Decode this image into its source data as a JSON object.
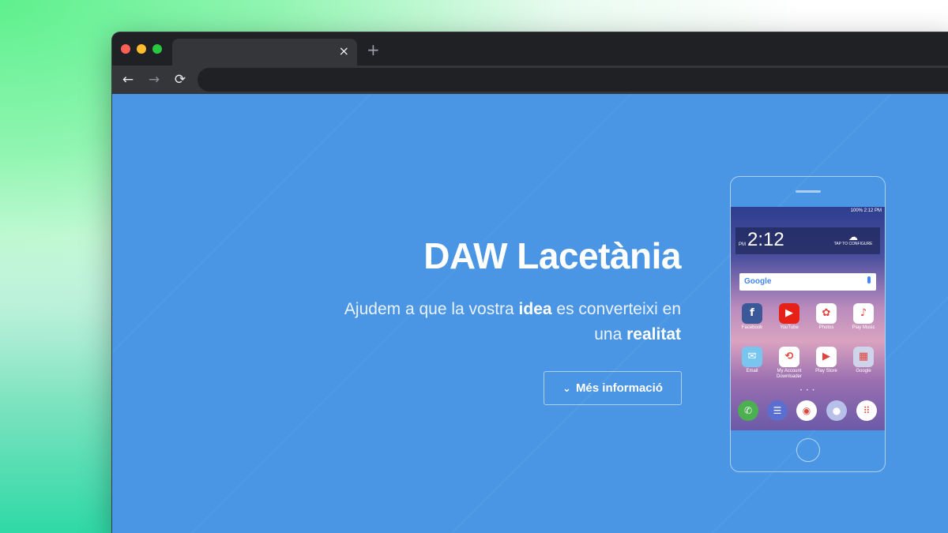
{
  "browser": {
    "tab_close": "×",
    "new_tab": "+",
    "nav": {
      "back": "←",
      "forward": "→",
      "reload": "⟳"
    }
  },
  "hero": {
    "title": "DAW Lacetània",
    "subtitle_1": "Ajudem a que la vostra ",
    "subtitle_bold_1": "idea",
    "subtitle_2": " es converteixi en una ",
    "subtitle_bold_2": "realitat",
    "button_icon": "chevron-down-icon",
    "button_label": "Més informació"
  },
  "phone": {
    "status": "100% 2:12 PM",
    "clock_ampm": "PM",
    "clock_time": "2:12",
    "weather_label": "TAP TO CONFIGURE",
    "search_logo": "Google",
    "apps": [
      {
        "label": "Facebook",
        "glyph": "f",
        "color": "#3b5998"
      },
      {
        "label": "YouTube",
        "glyph": "▶",
        "color": "#e62117"
      },
      {
        "label": "Photos",
        "glyph": "✿",
        "color": "#ffffff"
      },
      {
        "label": "Play Music",
        "glyph": "♪",
        "color": "#ffffff"
      },
      {
        "label": "Email",
        "glyph": "✉",
        "color": "#78c6f0"
      },
      {
        "label": "My Account Downloader",
        "glyph": "⟲",
        "color": "#ffffff"
      },
      {
        "label": "Play Store",
        "glyph": "▶",
        "color": "#ffffff"
      },
      {
        "label": "Google",
        "glyph": "▦",
        "color": "#d0d4ea"
      }
    ],
    "pager": "• • •",
    "dock": [
      {
        "name": "phone-icon",
        "glyph": "✆",
        "color": "#4caf50"
      },
      {
        "name": "messages-icon",
        "glyph": "☰",
        "color": "#5a6fd0"
      },
      {
        "name": "chrome-icon",
        "glyph": "◉",
        "color": "#ffffff"
      },
      {
        "name": "camera-icon",
        "glyph": "●",
        "color": "#b7c0e8"
      },
      {
        "name": "apps-icon",
        "glyph": "⠿",
        "color": "#ffffff"
      }
    ]
  },
  "colors": {
    "page_bg": "#4a96e4",
    "browser_chrome": "#202124",
    "browser_toolbar": "#35363a"
  }
}
